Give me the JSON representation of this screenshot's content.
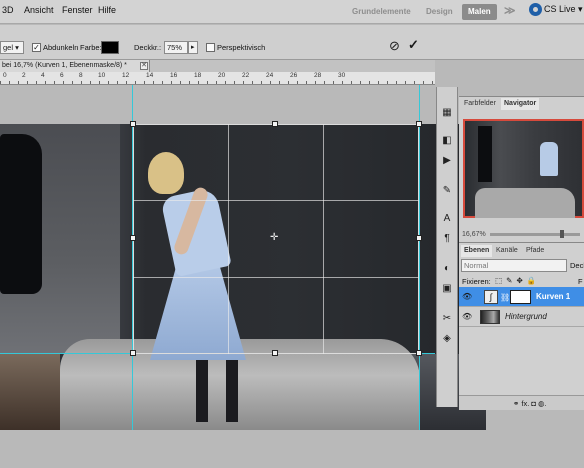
{
  "menubar": {
    "items": [
      "3D",
      "Ansicht",
      "Fenster",
      "Hilfe"
    ],
    "workspaces": [
      "Grundelemente",
      "Design",
      "Malen"
    ],
    "active_workspace": "Malen",
    "more": "≫",
    "cs_live": "CS Live ▾"
  },
  "options": {
    "mode_value": "gel",
    "darken_checkbox_label": "Abdunkeln",
    "darken_checked": true,
    "color_label": "Farbe:",
    "opacity_label": "Deckkr.:",
    "opacity_value": "75%",
    "perspective_label": "Perspektivisch",
    "perspective_checked": false,
    "cancel_icon": "⊘",
    "commit_icon": "✓"
  },
  "document": {
    "tab_title": "bei 16,7% (Kurven 1, Ebenenmaske/8) *",
    "close_icon": "✕",
    "ruler_numbers": [
      "0",
      "2",
      "4",
      "6",
      "8",
      "10",
      "12",
      "14",
      "16",
      "18",
      "20",
      "22",
      "24",
      "26",
      "28",
      "30"
    ]
  },
  "navigator": {
    "tabs": [
      "Farbfelder",
      "Navigator"
    ],
    "zoom": "16,67%"
  },
  "layers": {
    "tabs": [
      "Ebenen",
      "Kanäle",
      "Pfade"
    ],
    "blend_mode": "Normal",
    "opacity_label": "Deck",
    "lock_label": "Fixieren:",
    "lock_icons": "⬚ ✎ ✥ 🔒",
    "fill_label": "F",
    "rows": [
      {
        "name": "Kurven 1",
        "selected": true
      },
      {
        "name": "Hintergrund",
        "selected": false
      }
    ],
    "footer_icons": "⚭  fx.  ◘  ◍."
  },
  "colors": {
    "accent": "#3f8ee6",
    "guide": "#35c8d8",
    "nav_frame": "#d64a3c"
  }
}
